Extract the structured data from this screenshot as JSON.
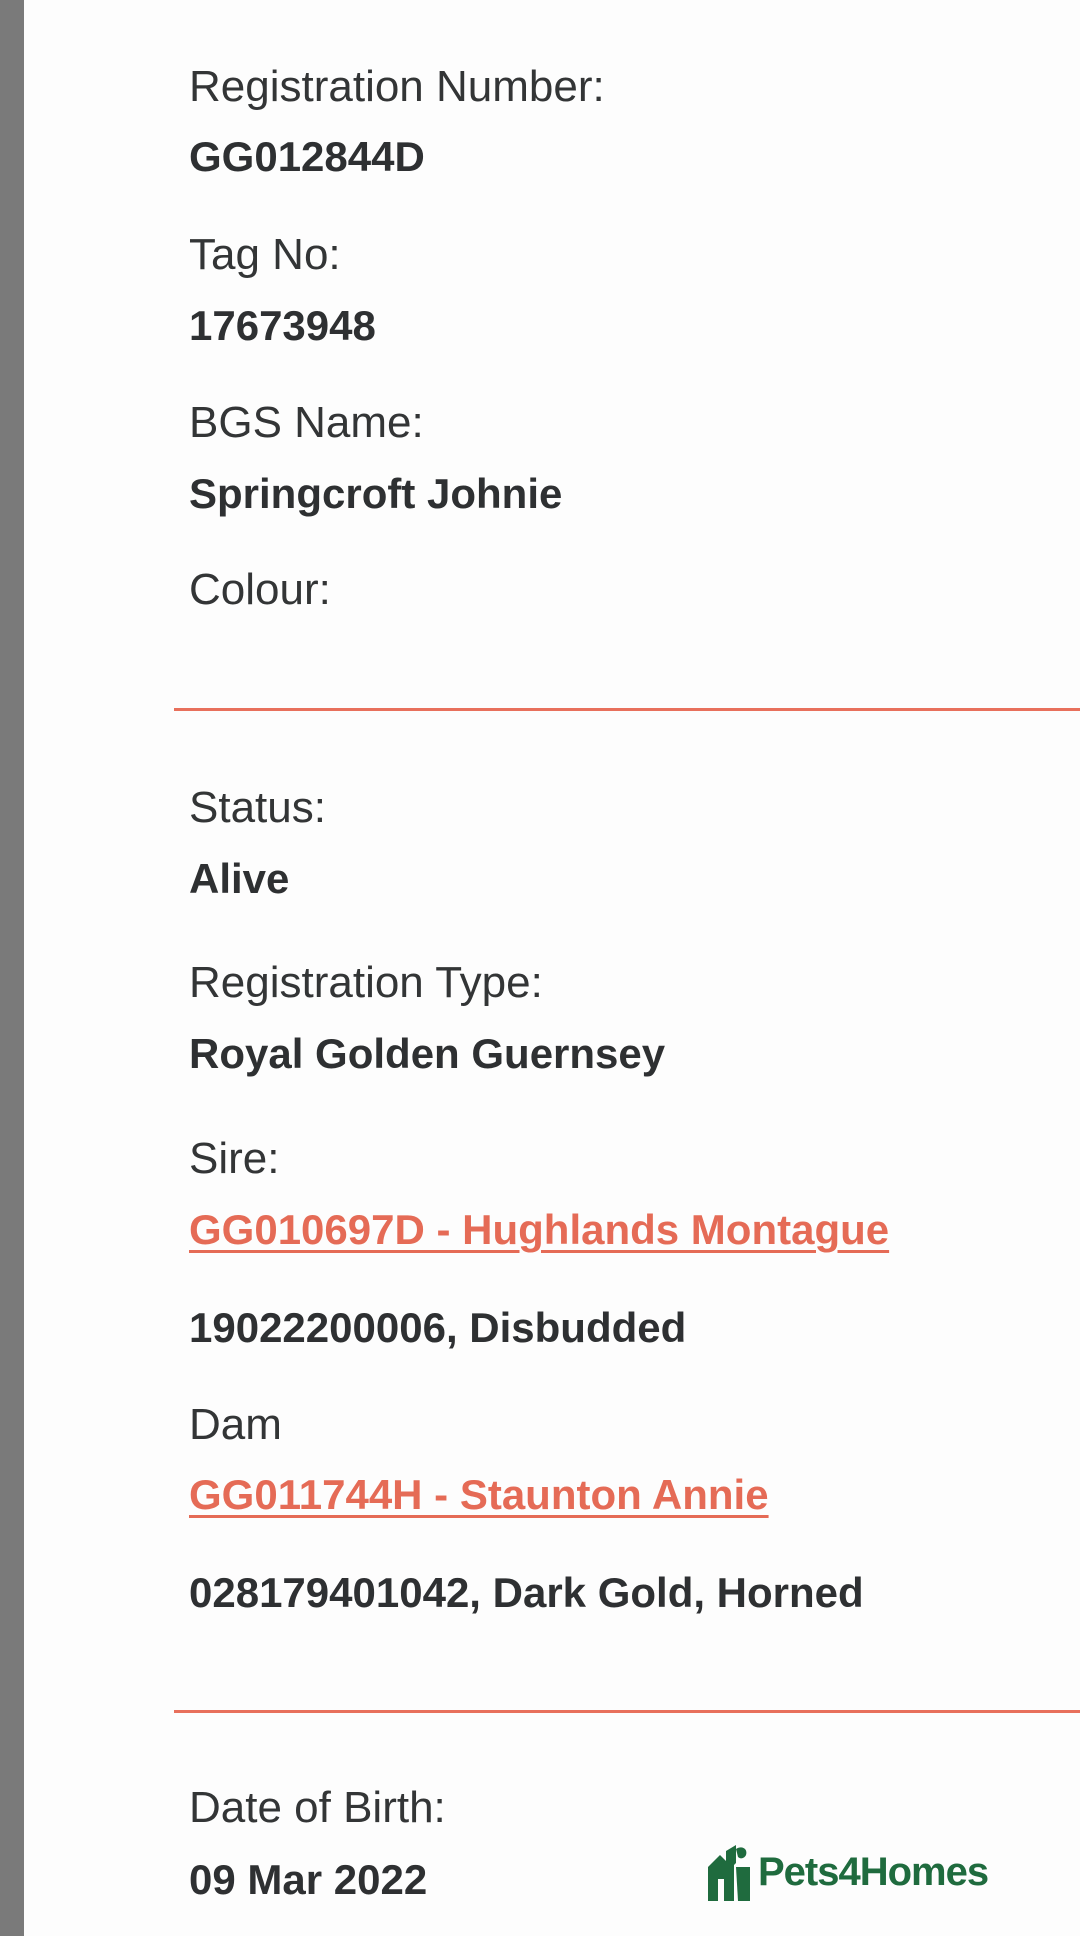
{
  "fields": {
    "registration_number": {
      "label": "Registration Number:",
      "value": "GG012844D"
    },
    "tag_no": {
      "label": "Tag No:",
      "value": "17673948"
    },
    "bgs_name": {
      "label": "BGS Name:",
      "value": "Springcroft Johnie"
    },
    "colour": {
      "label": "Colour:",
      "value": ""
    },
    "status": {
      "label": "Status:",
      "value": "Alive"
    },
    "registration_type": {
      "label": "Registration Type:",
      "value": "Royal Golden Guernsey"
    },
    "sire": {
      "label": "Sire:",
      "link": "GG010697D - Hughlands Montague",
      "details": "19022200006, Disbudded"
    },
    "dam": {
      "label": "Dam",
      "link": "GG011744H - Staunton Annie",
      "details": "028179401042, Dark Gold, Horned"
    },
    "date_of_birth": {
      "label": "Date of Birth:",
      "value": "09 Mar 2022"
    }
  },
  "watermark": {
    "brand": "Pets4Homes",
    "icon": "house-pets-logo-icon"
  },
  "colors": {
    "accent": "#e56b56",
    "text": "#2e3032",
    "brand": "#1f6b3e"
  }
}
